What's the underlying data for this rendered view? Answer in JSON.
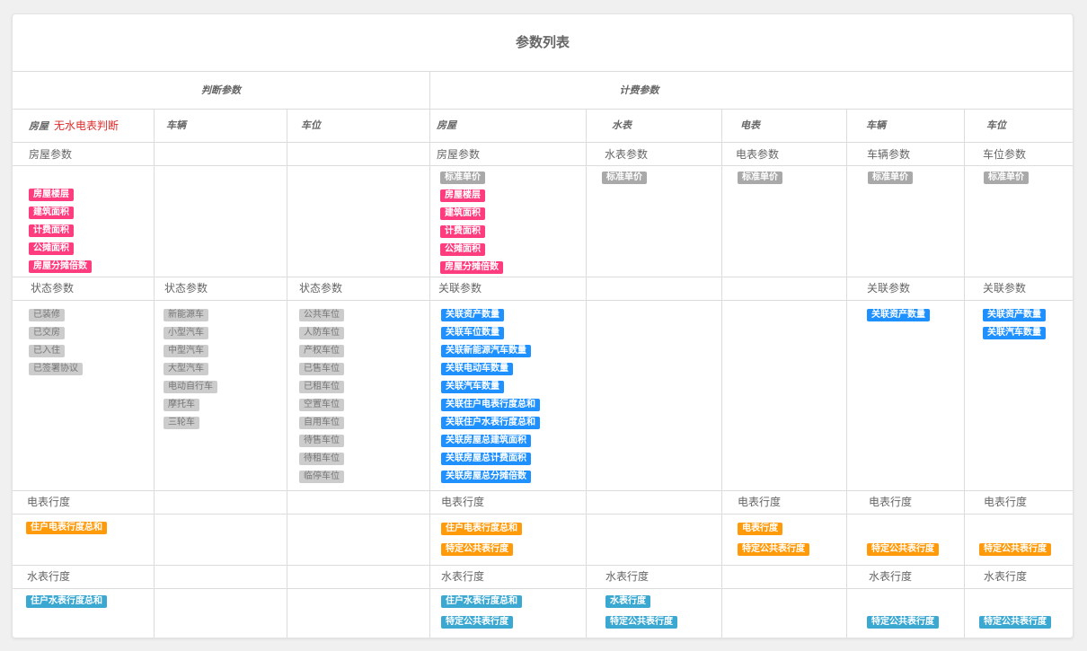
{
  "title": "参数列表",
  "groups": {
    "judge": "判断参数",
    "billing": "计费参数"
  },
  "columns": {
    "house": "房屋",
    "no_meter": "无水电表判断",
    "vehicle": "车辆",
    "parking": "车位",
    "b_house": "房屋",
    "b_water": "水表",
    "b_elec": "电表",
    "b_vehicle": "车辆",
    "b_parking": "车位"
  },
  "sections": {
    "house_params": "房屋参数",
    "water_params": "水表参数",
    "elec_params": "电表参数",
    "vehicle_params": "车辆参数",
    "parking_params": "车位参数",
    "status_params": "状态参数",
    "relation_params": "关联参数",
    "elec_reading": "电表行度",
    "water_reading": "水表行度"
  },
  "tags": {
    "judge_house_params": [
      "房屋楼层",
      "建筑面积",
      "计费面积",
      "公摊面积",
      "房屋分摊倍数"
    ],
    "billing_house_params": [
      "标准单价",
      "房屋楼层",
      "建筑面积",
      "计费面积",
      "公摊面积",
      "房屋分摊倍数"
    ],
    "water_price": "标准单价",
    "elec_price": "标准单价",
    "vehicle_price": "标准单价",
    "parking_price": "标准单价",
    "house_status": [
      "已装修",
      "已交房",
      "已入住",
      "已签署协议"
    ],
    "vehicle_status": [
      "新能源车",
      "小型汽车",
      "中型汽车",
      "大型汽车",
      "电动自行车",
      "摩托车",
      "三轮车"
    ],
    "parking_status": [
      "公共车位",
      "人防车位",
      "产权车位",
      "已售车位",
      "已租车位",
      "空置车位",
      "自用车位",
      "待售车位",
      "待租车位",
      "临停车位"
    ],
    "house_relations": [
      "关联资产数量",
      "关联车位数量",
      "关联新能源汽车数量",
      "关联电动车数量",
      "关联汽车数量",
      "关联住户电表行度总和",
      "关联住户水表行度总和",
      "关联房屋总建筑面积",
      "关联房屋总计费面积",
      "关联房屋总分摊倍数"
    ],
    "vehicle_relations": [
      "关联资产数量"
    ],
    "parking_relations": [
      "关联资产数量",
      "关联汽车数量"
    ],
    "judge_elec": "住户电表行度总和",
    "house_elec": [
      "住户电表行度总和",
      "特定公共表行度"
    ],
    "elec_elec": [
      "电表行度",
      "特定公共表行度"
    ],
    "vehicle_elec": "特定公共表行度",
    "parking_elec": "特定公共表行度",
    "judge_water": "住户水表行度总和",
    "house_water": [
      "住户水表行度总和",
      "特定公共表行度"
    ],
    "water_water": [
      "水表行度",
      "特定公共表行度"
    ],
    "vehicle_water": "特定公共表行度",
    "parking_water": "特定公共表行度"
  },
  "colors": {
    "pink": "#ff3c7e",
    "blue": "#1e90ff",
    "orange": "#ff9a0a",
    "teal": "#3ba8d2",
    "grey": "#cccccc",
    "warn": "#e02a2a"
  }
}
